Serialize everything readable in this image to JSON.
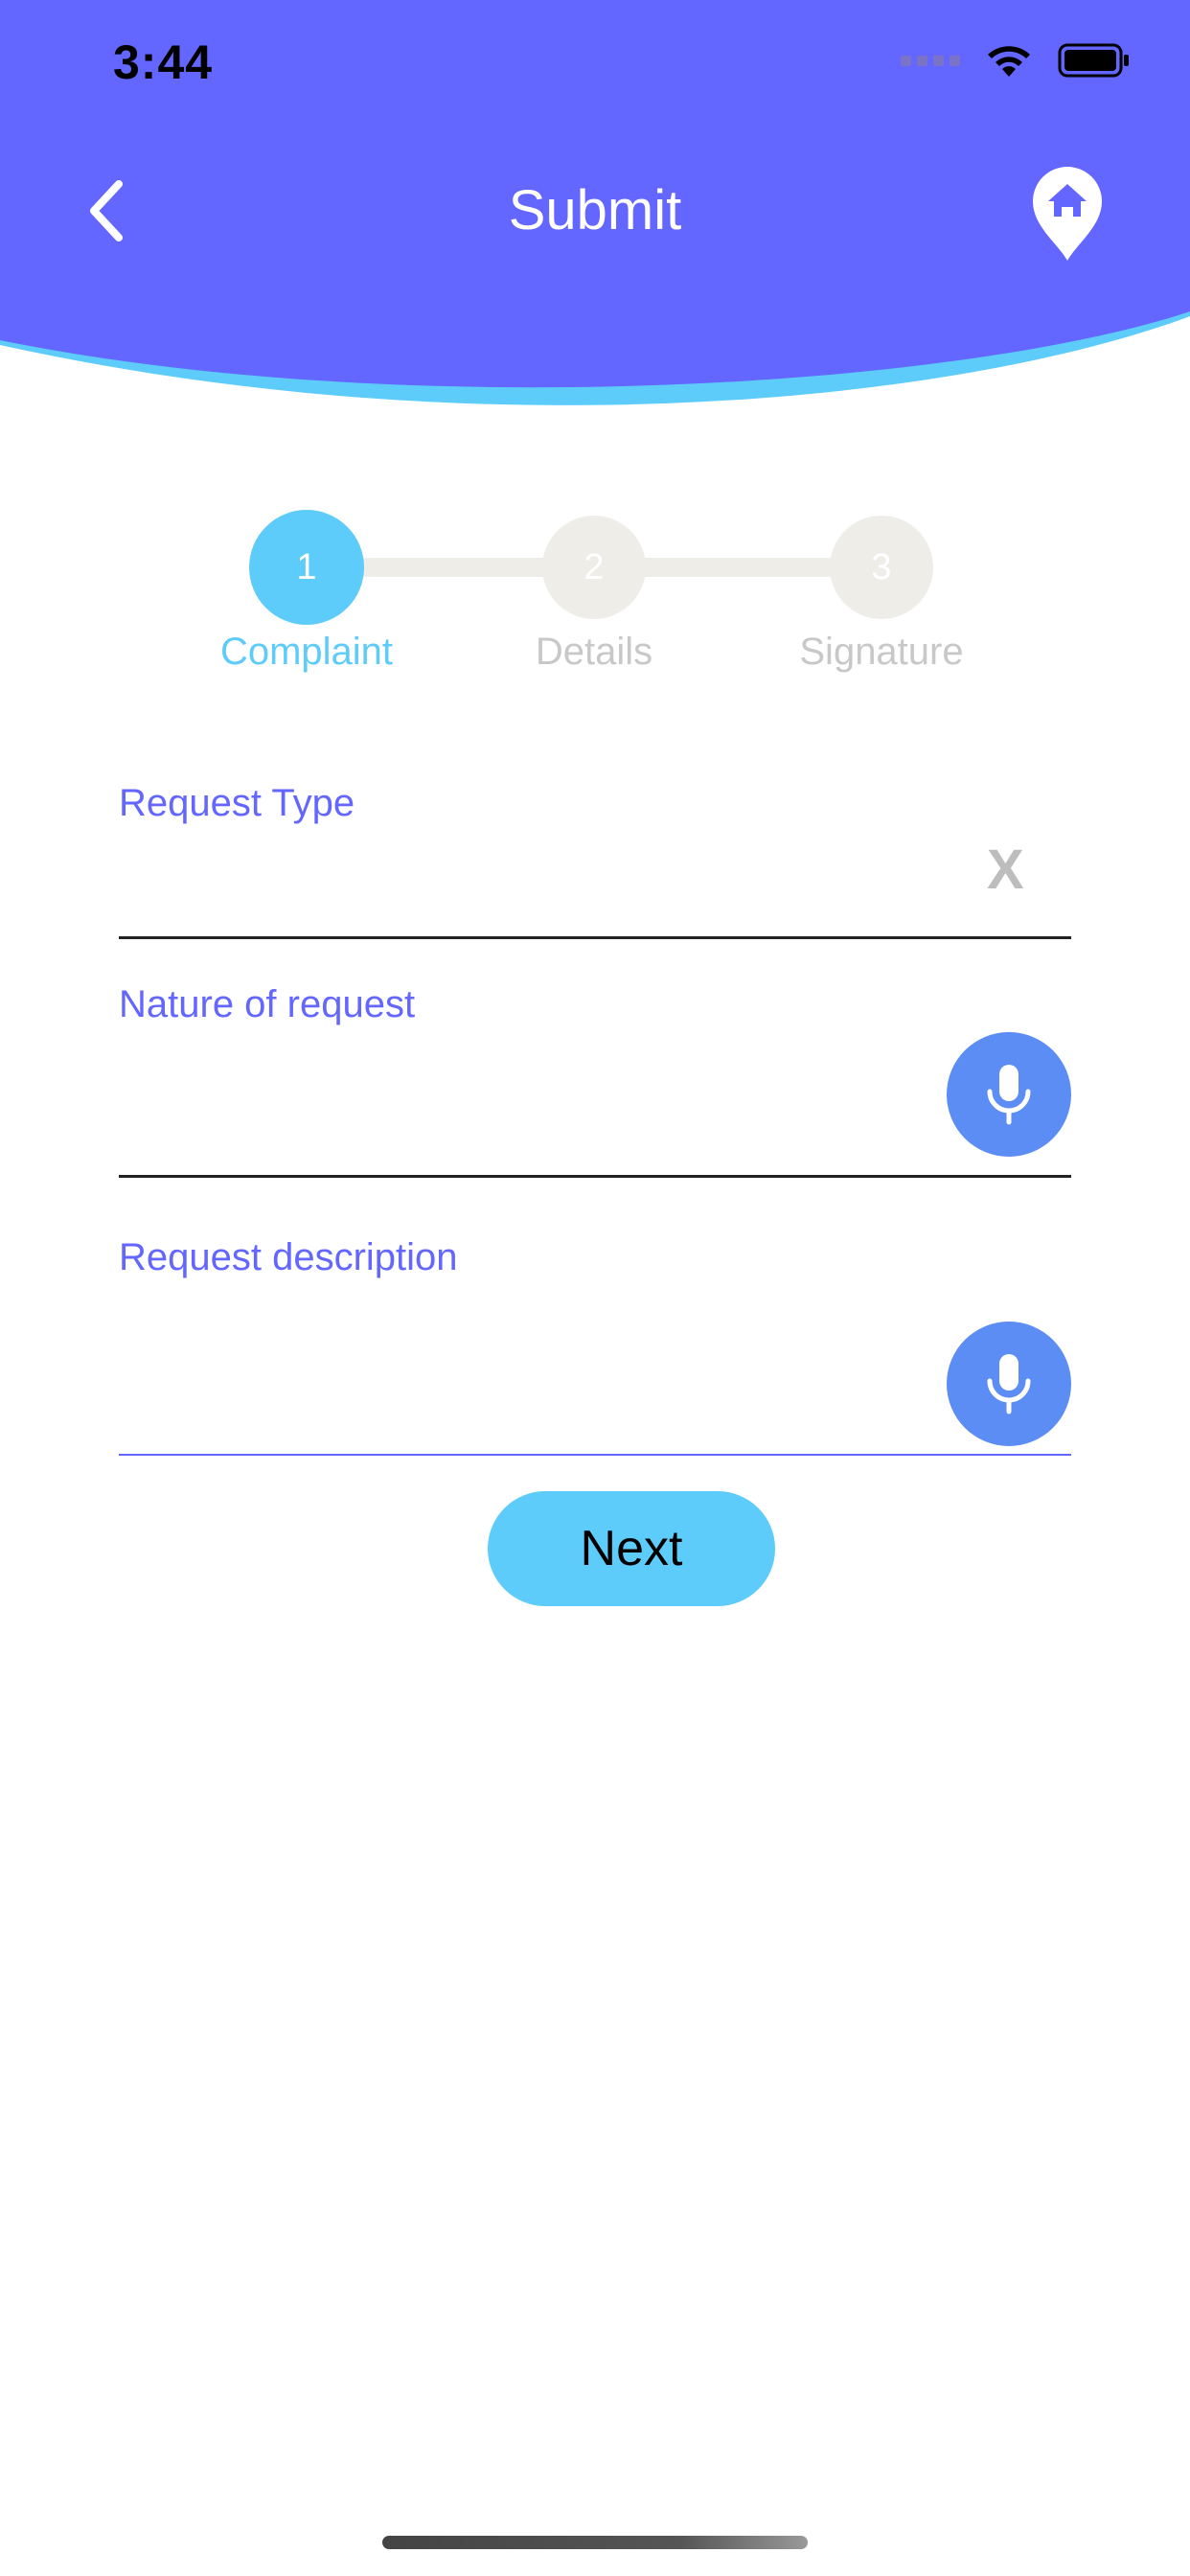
{
  "status_bar": {
    "time": "3:44"
  },
  "header": {
    "title": "Submit",
    "back_icon": "chevron-left-icon",
    "home_icon": "home-location-pin-icon"
  },
  "colors": {
    "header_primary": "#6366FF",
    "header_wave_accent": "#5ECCFB",
    "step_active": "#5ECCFB",
    "step_inactive": "#EEEDE8",
    "label_color": "#6366FF",
    "mic_button": "#5B8DF5",
    "next_button": "#5ECCFB"
  },
  "stepper": {
    "steps": [
      {
        "number": "1",
        "label": "Complaint",
        "active": true
      },
      {
        "number": "2",
        "label": "Details",
        "active": false
      },
      {
        "number": "3",
        "label": "Signature",
        "active": false
      }
    ]
  },
  "form": {
    "request_type": {
      "label": "Request Type",
      "value": "",
      "clear_label": "X"
    },
    "nature_of_request": {
      "label": "Nature of request",
      "value": "",
      "mic_icon": "microphone-icon"
    },
    "request_description": {
      "label": "Request description",
      "value": "",
      "mic_icon": "microphone-icon"
    }
  },
  "actions": {
    "next_label": "Next"
  }
}
